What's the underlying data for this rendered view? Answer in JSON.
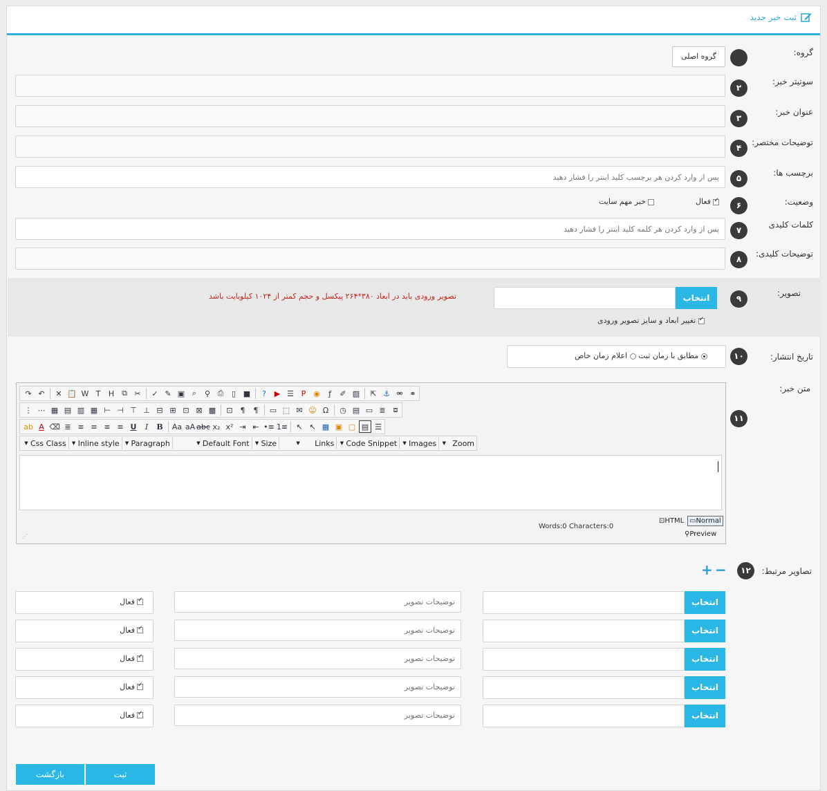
{
  "header": {
    "title": "ثبت خبر جدید",
    "icon": "edit-icon"
  },
  "fields": {
    "group": {
      "label": "گروه:",
      "button": "گروه اصلی"
    },
    "subtitle": {
      "label": "سوتیتر خبر:",
      "num": "۲",
      "value": ""
    },
    "title": {
      "label": "عنوان خبر:",
      "num": "۳",
      "value": ""
    },
    "summary": {
      "label": "توضیحات مختصر:",
      "num": "۴",
      "value": ""
    },
    "tags": {
      "label": "برچسب ها:",
      "num": "۵",
      "placeholder": "پس از وارد کردن هر برچسب کلید اینتر را فشار دهید"
    },
    "status": {
      "label": "وضعیت:",
      "num": "۶",
      "active": "فعال",
      "important": "خبر مهم سایت"
    },
    "keywords": {
      "label": "کلمات کلیدی",
      "num": "۷",
      "placeholder": "پس از وارد کردن هر کلمه کلید اینتر را فشار دهید"
    },
    "keydesc": {
      "label": "توضیحات کلیدی:",
      "num": "۸",
      "value": ""
    },
    "image": {
      "label": "تصویر:",
      "num": "۹",
      "choose": "انتخاب",
      "warning": "تصویر ورودی باید در ابعاد ۳۸۰*۲۶۴ پیکسل و حجم کمتر از ۱۰۲۴ کیلوبایت باشد",
      "resize": "تغییر ابعاد و سایز تصویر ورودی"
    },
    "publish": {
      "label": "تاریخ انتشار:",
      "num": "۱۰",
      "opt1": "مطابق با زمان ثبت",
      "opt2": "اعلام زمان خاص"
    },
    "body": {
      "label": "متن خبر:",
      "num": "۱۱"
    },
    "related": {
      "label": "تصاویر مرتبط:",
      "num": "۱۲",
      "plus": "+",
      "minus": "−"
    }
  },
  "editor": {
    "dropdowns": [
      "Css Class",
      "Inline style",
      "Paragraph",
      "Default Font",
      "Size",
      "Links",
      "Code Snippet",
      "Images",
      "Zoom"
    ],
    "words": "Words:0 Characters:0",
    "html_mode": "HTML",
    "normal_mode": "Normal",
    "preview": "Preview",
    "toolbar_icons": [
      "redo-icon",
      "undo-icon",
      "delete-icon",
      "paste-icon",
      "paste-word-icon",
      "paste-text-icon",
      "paste-html-icon",
      "copy-icon",
      "cut-icon",
      "spellcheck-icon",
      "cleanup-icon",
      "form-icon",
      "find-icon",
      "find-replace-icon",
      "print-icon",
      "new-doc-icon",
      "save-icon",
      "help-icon",
      "youtube-icon",
      "template-icon",
      "pdf-icon",
      "media-icon",
      "flash-icon",
      "edit-image-icon",
      "image-icon",
      "select-icon",
      "anchor-icon",
      "unlink-icon",
      "link-icon"
    ]
  },
  "related_rows": [
    {
      "choose": "انتخاب",
      "desc_placeholder": "توضیحات تصویر",
      "active": "فعال"
    },
    {
      "choose": "انتخاب",
      "desc_placeholder": "توضیحات تصویر",
      "active": "فعال"
    },
    {
      "choose": "انتخاب",
      "desc_placeholder": "توضیحات تصویر",
      "active": "فعال"
    },
    {
      "choose": "انتخاب",
      "desc_placeholder": "توضیحات تصویر",
      "active": "فعال"
    },
    {
      "choose": "انتخاب",
      "desc_placeholder": "توضیحات تصویر",
      "active": "فعال"
    }
  ],
  "actions": {
    "submit": "ثبت",
    "back": "بازگشت"
  },
  "colors": {
    "accent": "#2ab7e6",
    "warning": "#c0271e",
    "badge": "#3a3a3a"
  }
}
